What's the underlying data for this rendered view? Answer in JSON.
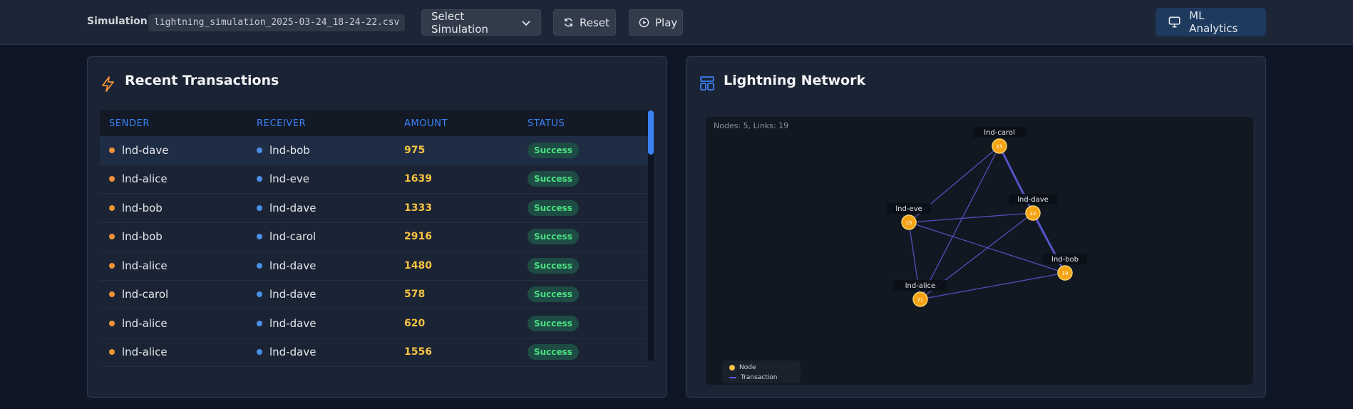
{
  "toolbar": {
    "sim_label": "Simulation:",
    "sim_file": "lightning_simulation_2025-03-24_18-24-22.csv",
    "select_label": "Select Simulation",
    "reset_label": "Reset",
    "play_label": "Play",
    "ml_label": "ML Analytics"
  },
  "transactions": {
    "title": "Recent Transactions",
    "columns": [
      "SENDER",
      "RECEIVER",
      "AMOUNT",
      "STATUS"
    ],
    "rows": [
      {
        "sender": "lnd-dave",
        "receiver": "lnd-bob",
        "amount": "975",
        "status": "Success"
      },
      {
        "sender": "lnd-alice",
        "receiver": "lnd-eve",
        "amount": "1639",
        "status": "Success"
      },
      {
        "sender": "lnd-bob",
        "receiver": "lnd-dave",
        "amount": "1333",
        "status": "Success"
      },
      {
        "sender": "lnd-bob",
        "receiver": "lnd-carol",
        "amount": "2916",
        "status": "Success"
      },
      {
        "sender": "lnd-alice",
        "receiver": "lnd-dave",
        "amount": "1480",
        "status": "Success"
      },
      {
        "sender": "lnd-carol",
        "receiver": "lnd-dave",
        "amount": "578",
        "status": "Success"
      },
      {
        "sender": "lnd-alice",
        "receiver": "lnd-dave",
        "amount": "620",
        "status": "Success"
      },
      {
        "sender": "lnd-alice",
        "receiver": "lnd-dave",
        "amount": "1556",
        "status": "Success"
      }
    ]
  },
  "network": {
    "title": "Lightning Network",
    "info": "Nodes: 5, Links: 19",
    "nodes": [
      {
        "id": "lnd-carol",
        "value": "15"
      },
      {
        "id": "lnd-dave",
        "value": "22"
      },
      {
        "id": "lnd-eve",
        "value": "15"
      },
      {
        "id": "lnd-bob",
        "value": "19"
      },
      {
        "id": "lnd-alice",
        "value": "21"
      }
    ],
    "links": [
      [
        "lnd-carol",
        "lnd-dave"
      ],
      [
        "lnd-carol",
        "lnd-eve"
      ],
      [
        "lnd-carol",
        "lnd-alice"
      ],
      [
        "lnd-carol",
        "lnd-bob"
      ],
      [
        "lnd-eve",
        "lnd-dave"
      ],
      [
        "lnd-eve",
        "lnd-alice"
      ],
      [
        "lnd-eve",
        "lnd-bob"
      ],
      [
        "lnd-dave",
        "lnd-bob"
      ],
      [
        "lnd-dave",
        "lnd-alice"
      ],
      [
        "lnd-alice",
        "lnd-bob"
      ]
    ],
    "legend": {
      "node": "Node",
      "transaction": "Transaction"
    }
  },
  "colors": {
    "accent": "#3b82f6",
    "node": "#f5c242",
    "link": "#5a5bd6",
    "sender_dot": "#f0923a",
    "receiver_dot": "#4a8fe8",
    "success": "#4ade80"
  },
  "icons": {
    "select": "chevron-down-icon",
    "reset": "refresh-icon",
    "play": "play-circle-icon",
    "ml": "monitor-icon",
    "transactions": "lightning-icon",
    "network": "layout-icon"
  }
}
